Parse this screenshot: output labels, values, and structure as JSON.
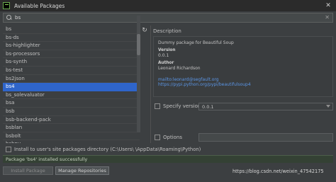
{
  "window": {
    "title": "Available Packages",
    "close": "✕"
  },
  "search": {
    "value": "bs",
    "clear": "✕"
  },
  "packages": [
    "bs",
    "bs-ds",
    "bs-highlighter",
    "bs-processors",
    "bs-synth",
    "bs-test",
    "bs2json",
    "bs4",
    "bs_solevaluator",
    "bsa",
    "bsb",
    "bsb-backend-pack",
    "bsblan",
    "bsbolt",
    "bsbpy"
  ],
  "selected_package": "bs4",
  "refresh_icon": "↻",
  "description": {
    "label": "Description",
    "summary": "Dummy package for Beautiful Soup",
    "version_head": "Version",
    "version": "0.0.1",
    "author_head": "Author",
    "author": "Leonard Richardson",
    "email": "mailto:leonard@segfault.org",
    "url": "https://pypi.python.org/pypi/beautifulsoup4"
  },
  "specify_version": {
    "label": "Specify version",
    "value": "0.0.1"
  },
  "options": {
    "label": "Options",
    "value": ""
  },
  "install_site": {
    "label": "Install to user's site packages directory (C:\\Users\\   \\AppData\\Roaming\\Python)"
  },
  "status": "Package 'bs4' installed successfully",
  "buttons": {
    "install": "Install Package",
    "manage": "Manage Repositories"
  },
  "watermark": "https://blog.csdn.net/weixin_47542175"
}
